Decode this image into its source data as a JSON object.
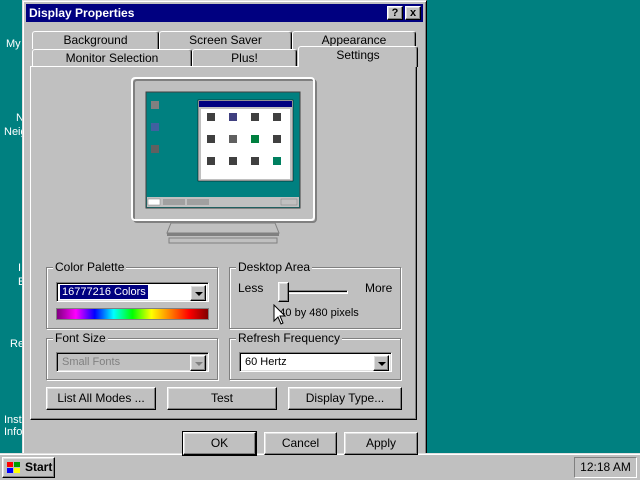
{
  "desktop": {
    "labels": [
      "My",
      "N",
      "Neig",
      "I",
      "E",
      "Re",
      "Inst",
      "Info"
    ]
  },
  "window": {
    "title": "Display Properties",
    "help_btn": "?",
    "close_btn": "x"
  },
  "tabs": {
    "row1": [
      "Background",
      "Screen Saver",
      "Appearance"
    ],
    "row2": [
      "Monitor Selection",
      "Plus!",
      "Settings"
    ]
  },
  "settings": {
    "color_palette": {
      "label": "Color Palette",
      "value": "16777216 Colors"
    },
    "desktop_area": {
      "label": "Desktop Area",
      "less": "Less",
      "more": "More",
      "resolution": "640 by 480 pixels"
    },
    "font_size": {
      "label": "Font Size",
      "value": "Small Fonts"
    },
    "refresh": {
      "label": "Refresh Frequency",
      "value": "60 Hertz"
    },
    "buttons": {
      "list_modes": "List All Modes ...",
      "test": "Test",
      "display_type": "Display Type..."
    }
  },
  "dialog_buttons": {
    "ok": "OK",
    "cancel": "Cancel",
    "apply": "Apply"
  },
  "taskbar": {
    "start": "Start",
    "clock": "12:18 AM"
  },
  "colors": {
    "desktop": "#008080",
    "titlebar": "#000080",
    "face": "#c0c0c0"
  }
}
